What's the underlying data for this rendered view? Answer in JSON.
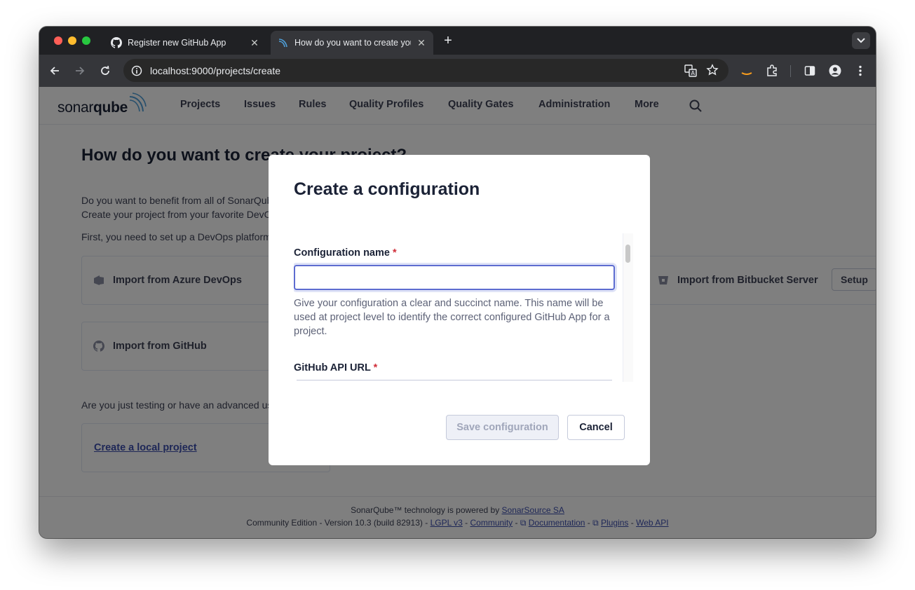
{
  "browser": {
    "tabs": [
      {
        "title": "Register new GitHub App",
        "favicon": "github-icon",
        "active": false
      },
      {
        "title": "How do you want to create your project?",
        "favicon": "sonarqube-icon",
        "active": true
      }
    ],
    "url_host": "localhost",
    "url_rest": ":9000/projects/create"
  },
  "nav": {
    "logo_sonar": "sonar",
    "logo_qube": "qube",
    "items": [
      "Projects",
      "Issues",
      "Rules",
      "Quality Profiles",
      "Quality Gates",
      "Administration",
      "More"
    ]
  },
  "page": {
    "title": "How do you want to create your project?",
    "para1": "Do you want to benefit from all of SonarQube's features (like repository import and Pull Request decoration)?",
    "para2": "Create your project from your favorite DevOps platform.",
    "para3": "First, you need to set up a DevOps platform configuration.",
    "azure_label": "Import from Azure DevOps",
    "bitbucket_server_label": "Import from Bitbucket Server",
    "github_label": "Import from GitHub",
    "setup_label": "Setup",
    "testing_text": "Are you just testing or have an advanced use-case? Create a local project.",
    "local_project_link": "Create a local project"
  },
  "footer": {
    "powered": "SonarQube™ technology is powered by ",
    "sonarsource": "SonarSource SA",
    "edition": "Community Edition - Version 10.3 (build 82913) - ",
    "lgpl": "LGPL v3",
    "community": "Community",
    "documentation": "Documentation",
    "plugins": "Plugins",
    "webapi": "Web API",
    "dash": " - "
  },
  "modal": {
    "title": "Create a configuration",
    "config_name_label": "Configuration name",
    "required_mark": "*",
    "config_name_value": "",
    "help_text": "Give your configuration a clear and succinct name. This name will be used at project level to identify the correct configured GitHub App for a project.",
    "api_url_label": "GitHub API URL",
    "save_label": "Save configuration",
    "cancel_label": "Cancel"
  }
}
